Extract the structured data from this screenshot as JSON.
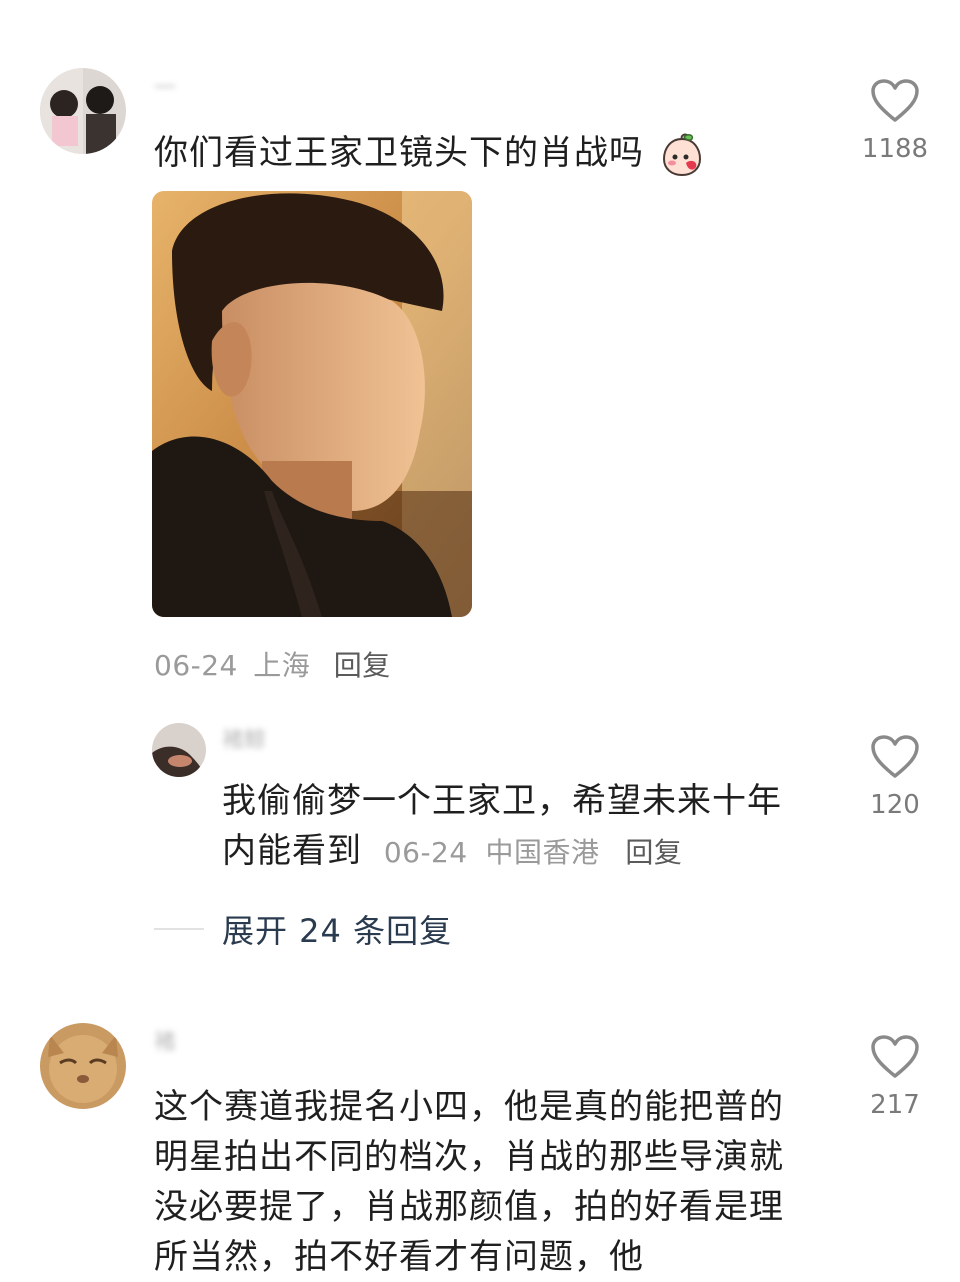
{
  "comments": [
    {
      "username": "一",
      "text": "你们看过王家卫镜头下的肖战吗",
      "date": "06-24",
      "location": "上海",
      "reply_label": "回复",
      "likes": "1188",
      "sticker_icon": "peach-sticker-icon"
    },
    {
      "username": "褚",
      "text": "这个赛道我提名小四，他是真的能把普的明星拍出不同的档次，肖战的那些导演就没必要提了，肖战那颜值，拍的好看是理所当然，拍不好看才有问题，他",
      "likes": "217"
    }
  ],
  "reply": {
    "username": "褚鲸",
    "text_line1": "我偷偷梦一个王家卫，希望未来十年",
    "text_line2": "内能看到",
    "date": "06-24",
    "location": "中国香港",
    "reply_label": "回复",
    "likes": "120"
  },
  "expand_replies_label": "展开 24 条回复",
  "colors": {
    "text_primary": "#1f1f1f",
    "meta_gray": "#9a9a9a",
    "like_icon": "#8a8a8a",
    "expand_link": "#2b3b4f"
  }
}
